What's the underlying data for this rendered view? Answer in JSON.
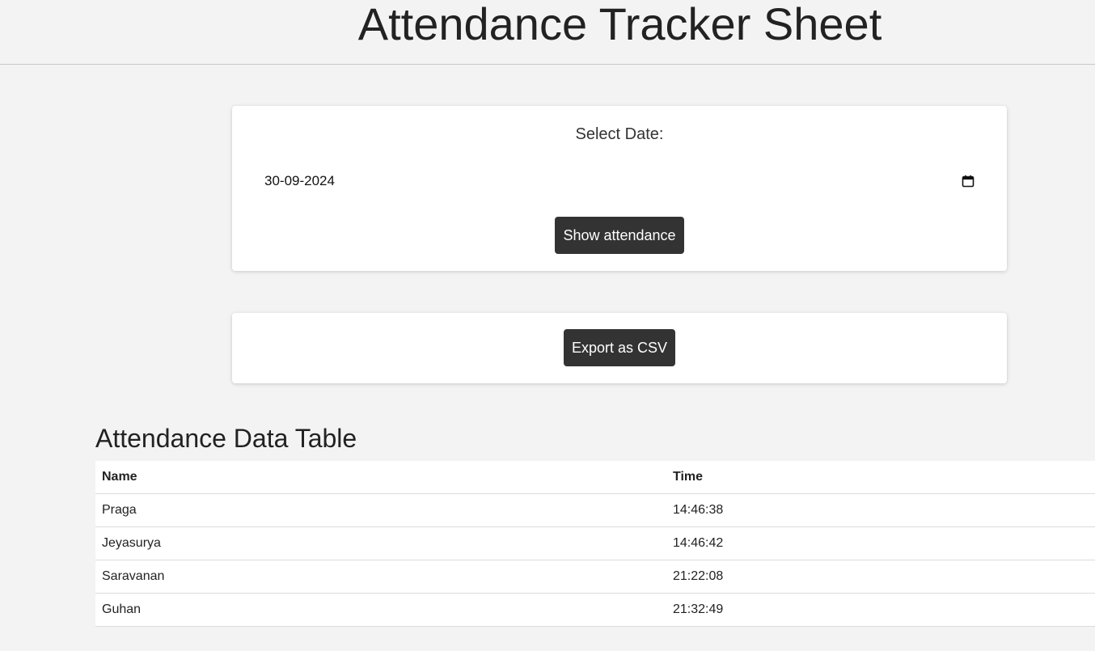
{
  "header": {
    "title": "Attendance Tracker Sheet"
  },
  "date_picker": {
    "label": "Select Date:",
    "value": "30-09-2024",
    "icon": "calendar-icon",
    "show_button_label": "Show attendance"
  },
  "export": {
    "button_label": "Export as CSV"
  },
  "table": {
    "title": "Attendance Data Table",
    "columns": [
      "Name",
      "Time"
    ],
    "rows": [
      [
        "Praga",
        "14:46:38"
      ],
      [
        "Jeyasurya",
        "14:46:42"
      ],
      [
        "Saravanan",
        "21:22:08"
      ],
      [
        "Guhan",
        "21:32:49"
      ]
    ]
  },
  "colors": {
    "background": "#f3f3f3",
    "card": "#ffffff",
    "button": "#333333",
    "button_text": "#ffffff"
  }
}
